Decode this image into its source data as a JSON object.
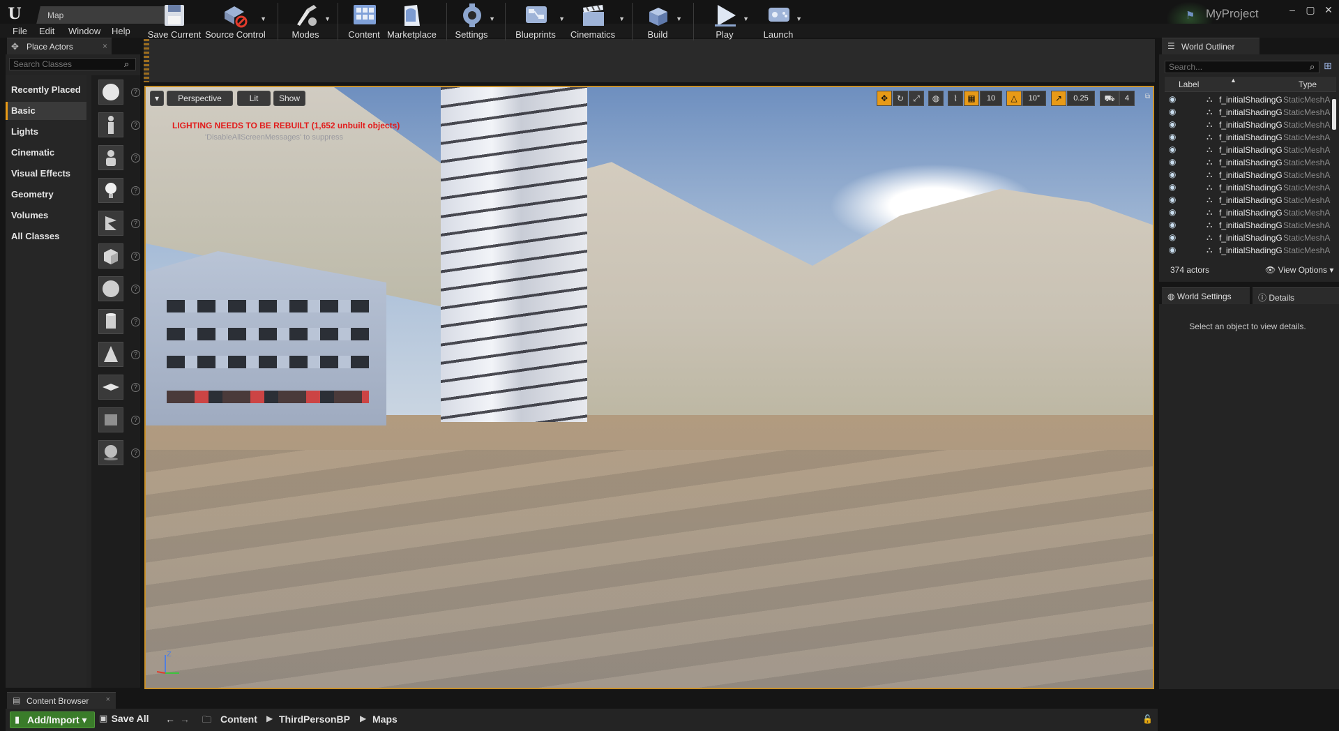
{
  "title_bar": {
    "doc_tab": "Map",
    "project_name": "MyProject",
    "controls": {
      "minimize": "–",
      "maximize": "▢",
      "close": "✕"
    }
  },
  "menu": {
    "items": [
      "File",
      "Edit",
      "Window",
      "Help"
    ]
  },
  "place_actors": {
    "tab_label": "Place Actors",
    "search_placeholder": "Search Classes",
    "categories": [
      "Recently Placed",
      "Basic",
      "Lights",
      "Cinematic",
      "Visual Effects",
      "Geometry",
      "Volumes",
      "All Classes"
    ],
    "active_category": "Basic",
    "actor_icons": [
      "sphere-icon",
      "character-icon",
      "pawn-icon",
      "light-bulb-icon",
      "player-start-icon",
      "cube-icon",
      "sphere-icon",
      "cylinder-icon",
      "cone-icon",
      "plane-icon",
      "box-trigger-icon",
      "sphere-trigger-icon"
    ]
  },
  "toolbar": {
    "buttons": [
      {
        "label": "Save Current",
        "icon": "save-icon",
        "has_menu": false
      },
      {
        "label": "Source Control",
        "icon": "source-control-icon",
        "has_menu": true
      },
      {
        "label": "Modes",
        "icon": "modes-icon",
        "has_menu": true
      },
      {
        "label": "Content",
        "icon": "content-icon",
        "has_menu": false
      },
      {
        "label": "Marketplace",
        "icon": "marketplace-icon",
        "has_menu": false
      },
      {
        "label": "Settings",
        "icon": "settings-icon",
        "has_menu": true
      },
      {
        "label": "Blueprints",
        "icon": "blueprints-icon",
        "has_menu": true
      },
      {
        "label": "Cinematics",
        "icon": "cinematics-icon",
        "has_menu": true
      },
      {
        "label": "Build",
        "icon": "build-icon",
        "has_menu": true
      },
      {
        "label": "Play",
        "icon": "play-icon",
        "has_menu": true
      },
      {
        "label": "Launch",
        "icon": "launch-icon",
        "has_menu": true
      }
    ]
  },
  "viewport": {
    "perspective_label": "Perspective",
    "lit_label": "Lit",
    "show_label": "Show",
    "warning": "LIGHTING NEEDS TO BE REBUILT (1,652 unbuilt objects)",
    "suppress_hint": "'DisableAllScreenMessages' to suppress",
    "grid_snap": "10",
    "rotation_snap": "10°",
    "scale_snap": "0.25",
    "camera_speed": "4",
    "accent_color": "#e89a17",
    "warning_color": "#e21b1b"
  },
  "world_outliner": {
    "tab_label": "World Outliner",
    "search_placeholder": "Search...",
    "col_label": "Label",
    "col_type": "Type",
    "rows": [
      {
        "name": "f_initialShadingG",
        "type": "StaticMeshActor"
      },
      {
        "name": "f_initialShadingG",
        "type": "StaticMeshActor"
      },
      {
        "name": "f_initialShadingG",
        "type": "StaticMeshActor"
      },
      {
        "name": "f_initialShadingG",
        "type": "StaticMeshActor"
      },
      {
        "name": "f_initialShadingG",
        "type": "StaticMeshActor"
      },
      {
        "name": "f_initialShadingG",
        "type": "StaticMeshActor"
      },
      {
        "name": "f_initialShadingG",
        "type": "StaticMeshActor"
      },
      {
        "name": "f_initialShadingG",
        "type": "StaticMeshActor"
      },
      {
        "name": "f_initialShadingG",
        "type": "StaticMeshActor"
      },
      {
        "name": "f_initialShadingG",
        "type": "StaticMeshActor"
      },
      {
        "name": "f_initialShadingG",
        "type": "StaticMeshActor"
      },
      {
        "name": "f_initialShadingG",
        "type": "StaticMeshActor"
      },
      {
        "name": "f_initialShadingG",
        "type": "StaticMeshActor"
      }
    ],
    "actor_count": "374 actors",
    "view_options": "View Options"
  },
  "details": {
    "world_settings_tab": "World Settings",
    "details_tab": "Details",
    "empty_message": "Select an object to view details."
  },
  "content_browser": {
    "tab_label": "Content Browser",
    "add_import": "Add/Import",
    "save_all": "Save All",
    "breadcrumb": [
      "Content",
      "ThirdPersonBP",
      "Maps"
    ]
  }
}
